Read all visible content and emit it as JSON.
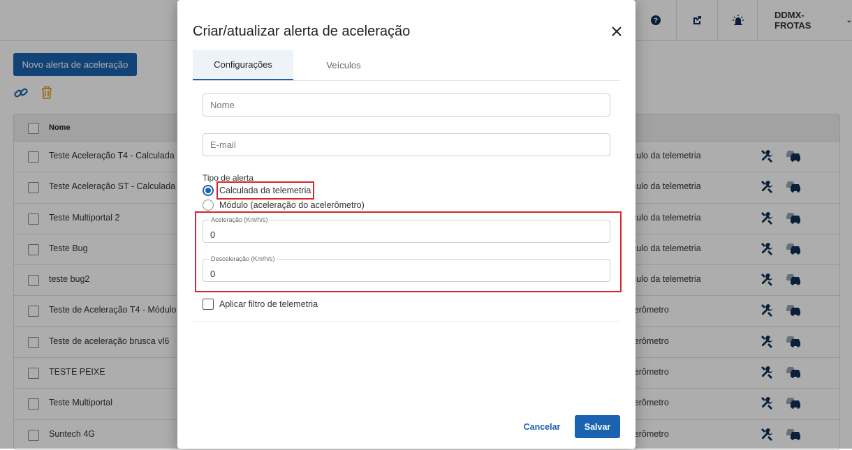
{
  "header": {
    "user_label": "DDMX-FROTAS",
    "icons": [
      "help-icon",
      "external-link-icon",
      "alarm-icon"
    ]
  },
  "page": {
    "new_button_label": "Novo alerta de aceleração",
    "table": {
      "header_name": "Nome",
      "rows": [
        {
          "name": "Teste Aceleração T4 - Calculada",
          "type": "culo da telemetria"
        },
        {
          "name": "Teste Aceleração ST - Calculada",
          "type": "culo da telemetria"
        },
        {
          "name": "Teste Multiportal 2",
          "type": "culo da telemetria"
        },
        {
          "name": "Teste Bug",
          "type": "culo da telemetria"
        },
        {
          "name": "teste bug2",
          "type": "culo da telemetria"
        },
        {
          "name": "Teste de Aceleração T4 - Módulo",
          "type": "lerômetro"
        },
        {
          "name": "Teste de aceleração brusca vl6",
          "type": "lerômetro"
        },
        {
          "name": "TESTE PEIXE",
          "type": "lerômetro"
        },
        {
          "name": "Teste Multiportal",
          "type": "lerômetro"
        },
        {
          "name": "Suntech 4G",
          "type": "lerômetro"
        }
      ]
    }
  },
  "modal": {
    "title": "Criar/atualizar alerta de aceleração",
    "tabs": [
      {
        "label": "Configurações"
      },
      {
        "label": "Veículos"
      }
    ],
    "name_placeholder": "Nome",
    "email_placeholder": "E-mail",
    "alert_type_label": "Tipo de alerta",
    "options": [
      {
        "label": "Calculada da telemetria",
        "selected": true
      },
      {
        "label": "Módulo (aceleração do acelerômetro)",
        "selected": false
      }
    ],
    "acceleration_label": "Aceleração (Km/h/s)",
    "acceleration_value": "0",
    "deceleration_label": "Desceleração (Km/h/s)",
    "deceleration_value": "0",
    "filter_label": "Aplicar filtro de telemetria",
    "cancel_label": "Cancelar",
    "save_label": "Salvar"
  },
  "colors": {
    "primary": "#1b63b0",
    "highlight": "#d9252b",
    "trash": "#e5a02a"
  }
}
